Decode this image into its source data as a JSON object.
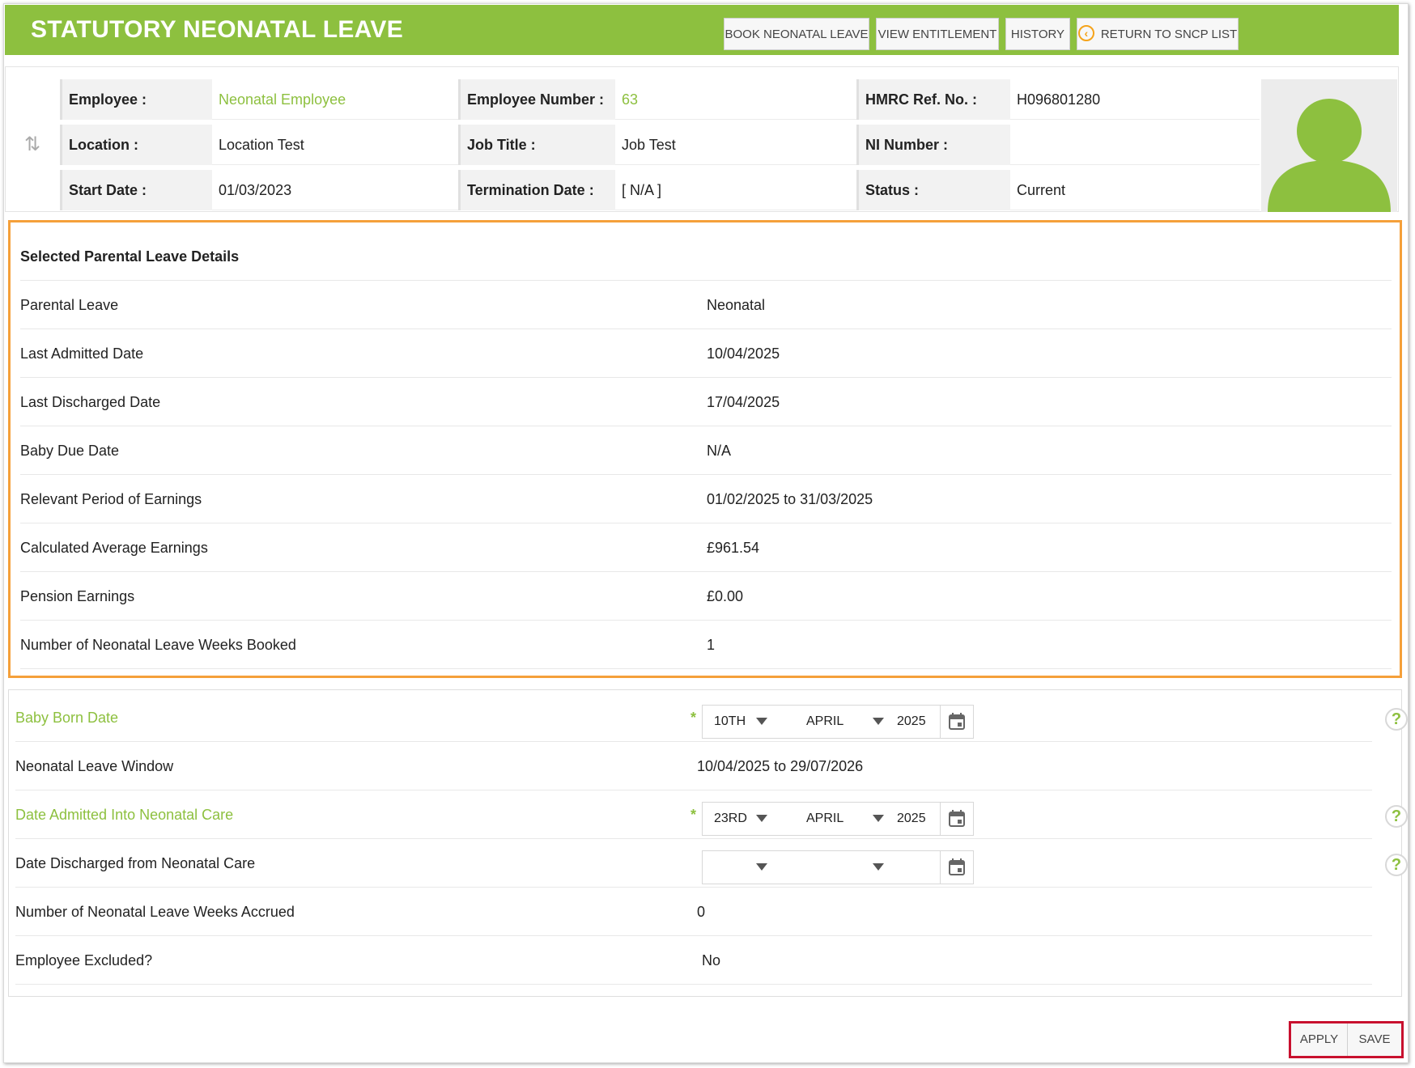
{
  "header": {
    "title": "STATUTORY NEONATAL LEAVE",
    "buttons": {
      "book": "BOOK NEONATAL LEAVE",
      "entitlement": "VIEW ENTITLEMENT",
      "history": "HISTORY",
      "return": "RETURN TO SNCP LIST"
    }
  },
  "employee": {
    "employee_label": "Employee :",
    "employee_value": "Neonatal Employee",
    "number_label": "Employee Number :",
    "number_value": "63",
    "hmrc_label": "HMRC Ref. No. :",
    "hmrc_value": "H096801280",
    "location_label": "Location :",
    "location_value": "Location Test",
    "job_label": "Job Title :",
    "job_value": "Job Test",
    "ni_label": "NI Number :",
    "ni_value": "",
    "start_label": "Start Date :",
    "start_value": "01/03/2023",
    "term_label": "Termination Date :",
    "term_value": "[ N/A ]",
    "status_label": "Status :",
    "status_value": "Current"
  },
  "details": {
    "heading": "Selected Parental Leave Details",
    "rows": [
      {
        "label": "Parental Leave",
        "value": "Neonatal"
      },
      {
        "label": "Last Admitted Date",
        "value": "10/04/2025"
      },
      {
        "label": "Last Discharged Date",
        "value": "17/04/2025"
      },
      {
        "label": "Baby Due Date",
        "value": "N/A"
      },
      {
        "label": "Relevant Period of Earnings",
        "value": "01/02/2025 to 31/03/2025"
      },
      {
        "label": "Calculated Average Earnings",
        "value": "£961.54"
      },
      {
        "label": "Pension Earnings",
        "value": "£0.00"
      },
      {
        "label": "Number of Neonatal Leave Weeks Booked",
        "value": "1"
      }
    ]
  },
  "form": {
    "baby_born": {
      "label": "Baby Born Date",
      "required": "*",
      "day": "10TH",
      "month": "APRIL",
      "year": "2025",
      "help": "?"
    },
    "window": {
      "label": "Neonatal Leave Window",
      "value": "10/04/2025 to 29/07/2026"
    },
    "admitted": {
      "label": "Date Admitted Into Neonatal Care",
      "required": "*",
      "day": "23RD",
      "month": "APRIL",
      "year": "2025",
      "help": "?"
    },
    "discharged": {
      "label": "Date Discharged from Neonatal Care",
      "day": "",
      "month": "",
      "year": "",
      "help": "?"
    },
    "accrued": {
      "label": "Number of Neonatal Leave Weeks Accrued",
      "value": "0"
    },
    "excluded": {
      "label": "Employee Excluded?",
      "value": "No"
    }
  },
  "actions": {
    "apply": "APPLY",
    "save": "SAVE"
  },
  "colors": {
    "brand_green": "#8dc03f",
    "highlight_orange": "#f5a03a",
    "highlight_red": "#c8102e"
  }
}
